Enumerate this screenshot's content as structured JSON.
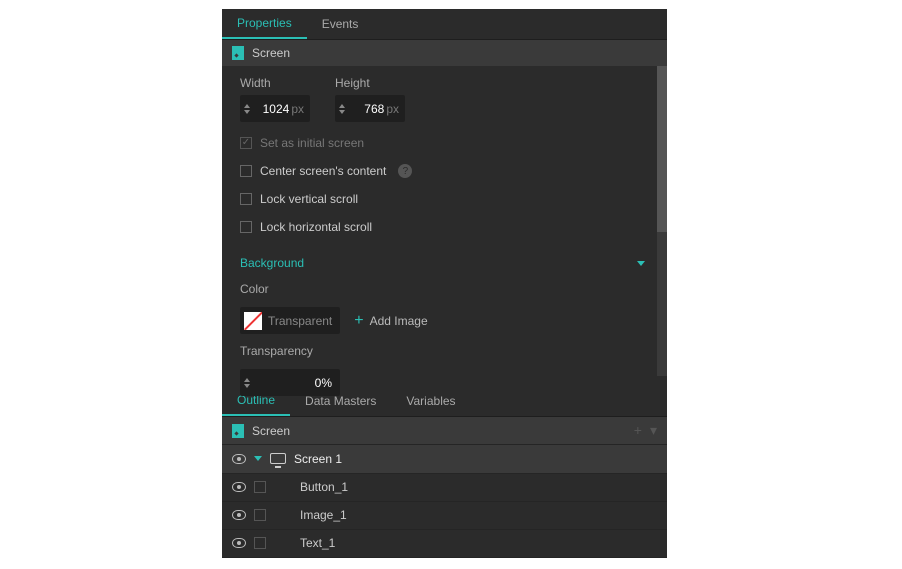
{
  "topTabs": {
    "properties": "Properties",
    "events": "Events"
  },
  "screenHeader": "Screen",
  "fields": {
    "widthLabel": "Width",
    "widthValue": "1024",
    "widthUnit": "px",
    "heightLabel": "Height",
    "heightValue": "768",
    "heightUnit": "px"
  },
  "checks": {
    "setInitial": "Set as initial screen",
    "centerContent": "Center screen's content",
    "lockVertical": "Lock vertical scroll",
    "lockHorizontal": "Lock horizontal scroll"
  },
  "background": {
    "title": "Background",
    "colorLabel": "Color",
    "colorValue": "Transparent",
    "addImage": "Add Image",
    "transparencyLabel": "Transparency",
    "transparencyValue": "0%"
  },
  "bottomTabs": {
    "outline": "Outline",
    "dataMasters": "Data Masters",
    "variables": "Variables"
  },
  "outline": {
    "root": "Screen",
    "items": [
      {
        "label": "Screen 1",
        "type": "screen"
      },
      {
        "label": "Button_1",
        "type": "leaf"
      },
      {
        "label": "Image_1",
        "type": "leaf"
      },
      {
        "label": "Text_1",
        "type": "leaf"
      }
    ]
  },
  "help": "?"
}
